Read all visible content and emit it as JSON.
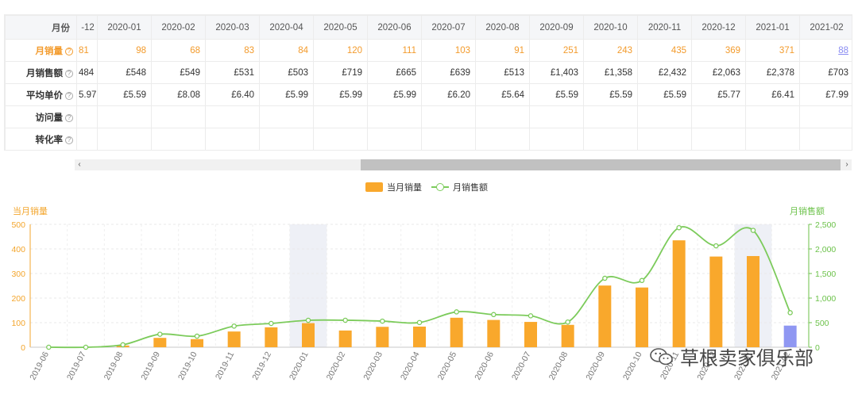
{
  "table": {
    "month_header": "月份",
    "first_col_header": "-12",
    "months": [
      "2020-01",
      "2020-02",
      "2020-03",
      "2020-04",
      "2020-05",
      "2020-06",
      "2020-07",
      "2020-08",
      "2020-09",
      "2020-10",
      "2020-11",
      "2020-12",
      "2021-01",
      "2021-02"
    ],
    "rows": [
      {
        "label": "月销量",
        "first": "81",
        "values": [
          "98",
          "68",
          "83",
          "84",
          "120",
          "111",
          "103",
          "91",
          "251",
          "243",
          "435",
          "369",
          "371",
          "88"
        ]
      },
      {
        "label": "月销售额",
        "first": "484",
        "values": [
          "£548",
          "£549",
          "£531",
          "£503",
          "£719",
          "£665",
          "£639",
          "£513",
          "£1,403",
          "£1,358",
          "£2,432",
          "£2,063",
          "£2,378",
          "£703"
        ]
      },
      {
        "label": "平均单价",
        "first": "5.97",
        "values": [
          "£5.59",
          "£8.08",
          "£6.40",
          "£5.99",
          "£5.99",
          "£5.99",
          "£6.20",
          "£5.64",
          "£5.59",
          "£5.59",
          "£5.59",
          "£5.77",
          "£6.41",
          "£7.99"
        ]
      },
      {
        "label": "访问量",
        "first": "",
        "values": [
          "",
          "",
          "",
          "",
          "",
          "",
          "",
          "",
          "",
          "",
          "",
          "",
          "",
          ""
        ]
      },
      {
        "label": "转化率",
        "first": "",
        "values": [
          "",
          "",
          "",
          "",
          "",
          "",
          "",
          "",
          "",
          "",
          "",
          "",
          "",
          ""
        ]
      }
    ],
    "help_glyph": "?"
  },
  "scrollbar": {
    "left_arrow": "‹",
    "right_arrow": "›"
  },
  "legend": {
    "bar_label": "当月销量",
    "line_label": "月销售额"
  },
  "colors": {
    "bar": "#f9a82c",
    "bar_current": "#8f97f2",
    "line": "#7ccb5b",
    "left_axis": "#f3a52c",
    "right_axis": "#6cc24a",
    "highlight": "#eef0f6"
  },
  "chart_data": {
    "type": "bar",
    "x": [
      "2019-06",
      "2019-07",
      "2019-08",
      "2019-09",
      "2019-10",
      "2019-11",
      "2019-12",
      "2020-01",
      "2020-02",
      "2020-03",
      "2020-04",
      "2020-05",
      "2020-06",
      "2020-07",
      "2020-08",
      "2020-09",
      "2020-10",
      "2020-11",
      "2020-12",
      "2021-01",
      "2021-02"
    ],
    "series": [
      {
        "name": "当月销量",
        "type": "bar",
        "axis": "left",
        "values": [
          0,
          0,
          7,
          38,
          33,
          64,
          81,
          98,
          68,
          83,
          84,
          120,
          111,
          103,
          91,
          251,
          243,
          435,
          369,
          371,
          88
        ]
      },
      {
        "name": "月销售额",
        "type": "line",
        "axis": "right",
        "values": [
          0,
          0,
          50,
          265,
          225,
          430,
          484,
          548,
          549,
          531,
          503,
          719,
          665,
          639,
          513,
          1403,
          1358,
          2432,
          2063,
          2378,
          703
        ]
      }
    ],
    "ylabel": "当月销量",
    "y2label": "月销售额",
    "ylim": [
      0,
      500
    ],
    "y2lim": [
      0,
      2500
    ],
    "yticks": [
      "0",
      "100",
      "200",
      "300",
      "400",
      "500"
    ],
    "y2ticks": [
      "0",
      "500",
      "1,000",
      "1,500",
      "2,000",
      "2,500"
    ],
    "highlighted_categories": [
      "2020-01",
      "2021-01"
    ],
    "current_category": "2021-02",
    "grid": true,
    "legend": "top-center"
  },
  "watermark": {
    "text": "草根卖家俱乐部",
    "icon": "wechat-icon"
  }
}
